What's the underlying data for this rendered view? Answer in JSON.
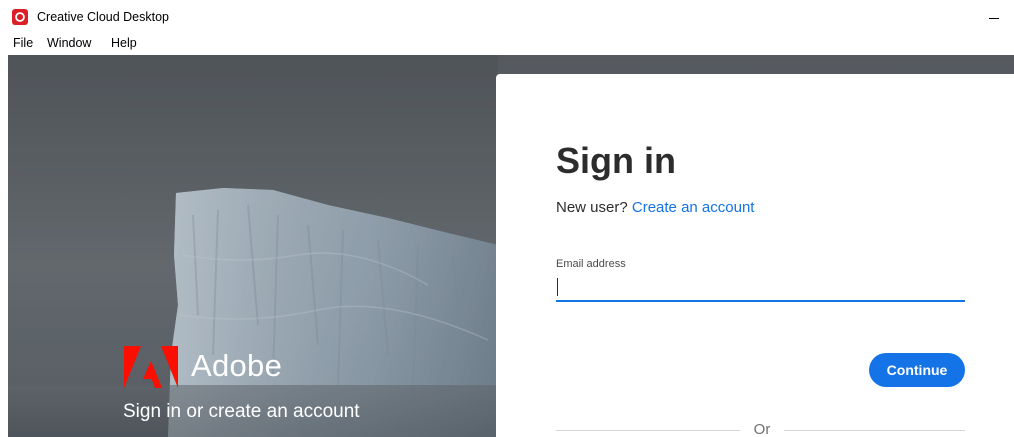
{
  "window": {
    "title": "Creative Cloud Desktop",
    "icon": "creative-cloud-icon",
    "controls": [
      "minimize"
    ]
  },
  "menubar": {
    "items": [
      {
        "label": "File"
      },
      {
        "label": "Window"
      },
      {
        "label": "Help"
      }
    ]
  },
  "branding": {
    "wordmark": "Adobe",
    "tagline": "Sign in or create an account",
    "logo_icon": "adobe-logo-icon",
    "logo_color": "#fa0f00"
  },
  "signin": {
    "title": "Sign in",
    "new_user_prompt": "New user?",
    "create_account_link": "Create an account",
    "email_label": "Email address",
    "email_value": "",
    "continue_label": "Continue",
    "or_divider": "Or"
  },
  "colors": {
    "accent": "#1473e6",
    "brand_red": "#da1f26"
  }
}
